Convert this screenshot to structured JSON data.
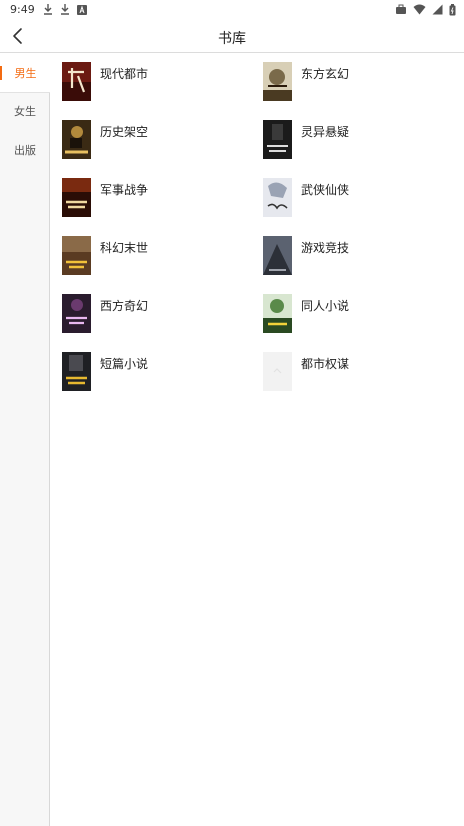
{
  "status_bar": {
    "time": "9:49",
    "left_icons": [
      "download-icon",
      "download-icon",
      "app-icon"
    ],
    "right_icons": [
      "briefcase-icon",
      "wifi-icon",
      "signal-icon",
      "battery-icon"
    ]
  },
  "header": {
    "back_icon": "chevron-left-icon",
    "title": "书库"
  },
  "sidebar": {
    "items": [
      {
        "label": "男生",
        "active": true
      },
      {
        "label": "女生",
        "active": false
      },
      {
        "label": "出版",
        "active": false
      }
    ],
    "accent_color": "#f36b12"
  },
  "categories": [
    {
      "label": "现代都市",
      "cover_color": "#6b1a12"
    },
    {
      "label": "东方玄幻",
      "cover_color": "#7a6a4a"
    },
    {
      "label": "历史架空",
      "cover_color": "#3a2a14"
    },
    {
      "label": "灵异悬疑",
      "cover_color": "#1b1b1b"
    },
    {
      "label": "军事战争",
      "cover_color": "#4a1c10"
    },
    {
      "label": "武侠仙侠",
      "cover_color": "#c9cdd6"
    },
    {
      "label": "科幻末世",
      "cover_color": "#5a3b22"
    },
    {
      "label": "游戏竞技",
      "cover_color": "#5b6270"
    },
    {
      "label": "西方奇幻",
      "cover_color": "#2a1c2e"
    },
    {
      "label": "同人小说",
      "cover_color": "#5a8a4a"
    },
    {
      "label": "短篇小说",
      "cover_color": "#1f2024"
    },
    {
      "label": "都市权谋",
      "cover_color": "#f2f2f2"
    }
  ]
}
